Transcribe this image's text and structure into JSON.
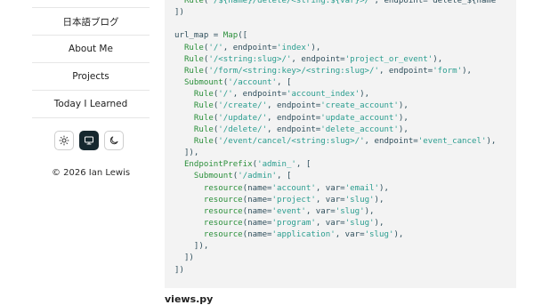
{
  "sidebar": {
    "nav_items": [
      {
        "label": "日本語ブログ"
      },
      {
        "label": "About Me"
      },
      {
        "label": "Projects"
      },
      {
        "label": "Today I Learned"
      }
    ],
    "theme_buttons": [
      {
        "icon": "sun-icon",
        "active": false
      },
      {
        "icon": "monitor-icon",
        "active": true
      },
      {
        "icon": "moon-icon",
        "active": false
      }
    ],
    "copyright": "© 2026 Ian Lewis"
  },
  "code": {
    "language": "python",
    "lines": [
      "  Rule('/${name}/delete/<string:${var}>/', endpoint='delete_${name",
      "])",
      "",
      "url_map = Map([",
      "  Rule('/', endpoint='index'),",
      "  Rule('/<string:slug>/', endpoint='project_or_event'),",
      "  Rule('/form/<string:key>/<string:slug>/', endpoint='form'),",
      "  Submount('/account', [",
      "    Rule('/', endpoint='account_index'),",
      "    Rule('/create/', endpoint='create_account'),",
      "    Rule('/update/', endpoint='update_account'),",
      "    Rule('/delete/', endpoint='delete_account'),",
      "    Rule('/event/cancel/<string:slug>/', endpoint='event_cancel'),",
      "  ]),",
      "  EndpointPrefix('admin_', [",
      "    Submount('/admin', [",
      "      resource(name='account', var='email'),",
      "      resource(name='project', var='slug'),",
      "      resource(name='event', var='slug'),",
      "      resource(name='program', var='slug'),",
      "      resource(name='application', var='slug'),",
      "    ]),",
      "  ])",
      "])"
    ]
  },
  "next_heading": "views.py"
}
